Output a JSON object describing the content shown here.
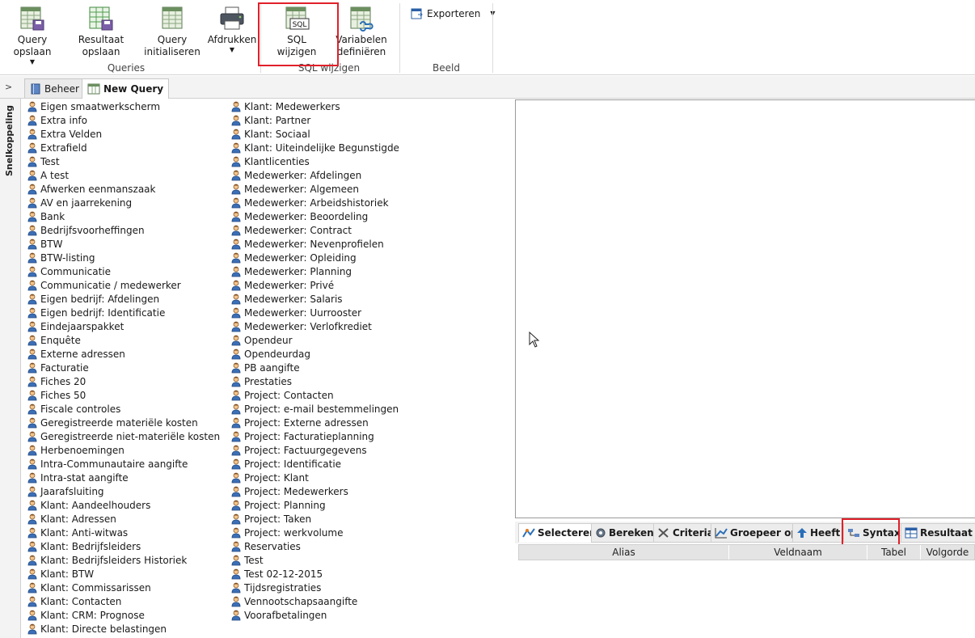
{
  "ribbon": {
    "buttons": {
      "query_opslaan": "Query opslaan",
      "resultaat_opslaan_1": "Resultaat",
      "resultaat_opslaan_2": "opslaan",
      "query_init_1": "Query",
      "query_init_2": "initialiseren",
      "afdrukken": "Afdrukken",
      "sql_wijzigen": "SQL wijzigen",
      "variabelen_1": "Variabelen",
      "variabelen_2": "definiëren",
      "exporteren": "Exporteren",
      "caret": "▼"
    },
    "groups": {
      "queries": "Queries",
      "sql_wijzigen": "SQL wijzigen",
      "beeld": "Beeld"
    },
    "sql_icon_text": "SQL"
  },
  "tabs": {
    "chevron": ">",
    "beheer": "Beheer",
    "new_query": "New Query"
  },
  "sidebar": {
    "label": "Snelkoppeling"
  },
  "entities_col1": [
    "Eigen smaatwerkscherm",
    "Extra info",
    "Extra Velden",
    "Extrafield",
    "Test",
    "A test",
    "Afwerken eenmanszaak",
    "AV en jaarrekening",
    "Bank",
    "Bedrijfsvoorheffingen",
    "BTW",
    "BTW-listing",
    "Communicatie",
    "Communicatie / medewerker",
    "Eigen bedrijf: Afdelingen",
    "Eigen bedrijf: Identificatie",
    "Eindejaarspakket",
    "Enquête",
    "Externe adressen",
    "Facturatie",
    "Fiches 20",
    "Fiches 50",
    "Fiscale controles",
    "Geregistreerde materiële kosten",
    "Geregistreerde niet-materiële kosten",
    "Herbenoemingen",
    "Intra-Communautaire aangifte",
    "Intra-stat aangifte",
    "Jaarafsluiting",
    "Klant: Aandeelhouders",
    "Klant: Adressen",
    "Klant: Anti-witwas",
    "Klant: Bedrijfsleiders",
    "Klant: Bedrijfsleiders Historiek",
    "Klant: BTW",
    "Klant: Commissarissen",
    "Klant: Contacten",
    "Klant: CRM: Prognose",
    "Klant: Directe belastingen"
  ],
  "entities_col2": [
    "Klant: Medewerkers",
    "Klant: Partner",
    "Klant: Sociaal",
    "Klant: Uiteindelijke Begunstigde",
    "Klantlicenties",
    "Medewerker: Afdelingen",
    "Medewerker: Algemeen",
    "Medewerker: Arbeidshistoriek",
    "Medewerker: Beoordeling",
    "Medewerker: Contract",
    "Medewerker: Nevenprofielen",
    "Medewerker: Opleiding",
    "Medewerker: Planning",
    "Medewerker: Privé",
    "Medewerker: Salaris",
    "Medewerker: Uurrooster",
    "Medewerker: Verlofkrediet",
    "Opendeur",
    "Opendeurdag",
    "PB aangifte",
    "Prestaties",
    "Project: Contacten",
    "Project: e-mail bestemmelingen",
    "Project: Externe adressen",
    "Project: Facturatieplanning",
    "Project: Factuurgegevens",
    "Project: Identificatie",
    "Project: Klant",
    "Project: Medewerkers",
    "Project: Planning",
    "Project: Taken",
    "Project: werkvolume",
    "Reservaties",
    "Test",
    "Test 02-12-2015",
    "Tijdsregistraties",
    "Vennootschapsaangifte",
    "Voorafbetalingen"
  ],
  "bottom_tabs": {
    "selecteren": "Selecteren",
    "bereken": "Bereken",
    "criteria": "Criteria",
    "groepeer_op": "Groepeer op",
    "heeft": "Heeft",
    "syntax": "Syntax",
    "resultaat": "Resultaat"
  },
  "grid_columns": [
    "Alias",
    "Veldnaam",
    "Tabel",
    "Volgorde"
  ],
  "colors": {
    "highlight": "#e0202a",
    "ribbon_bg": "#ffffff",
    "tab_bg": "#f3f3f3"
  }
}
